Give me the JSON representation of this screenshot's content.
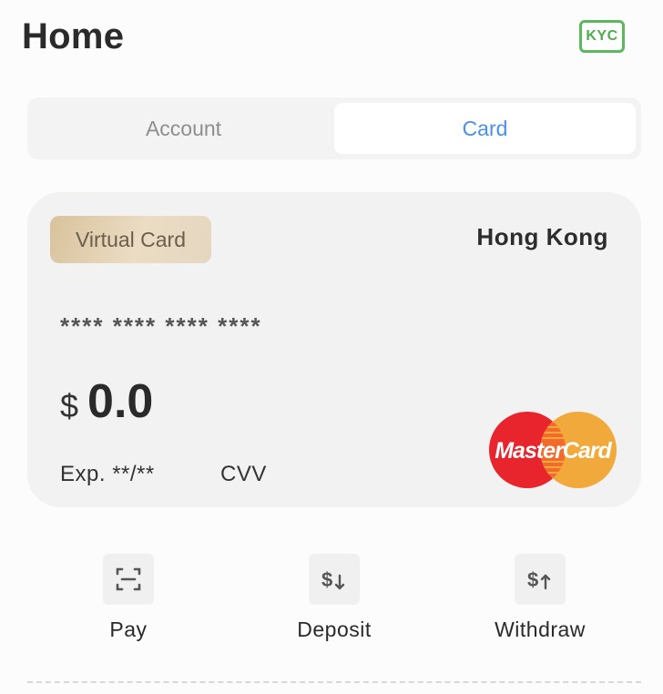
{
  "header": {
    "title": "Home",
    "kyc_label": "KYC"
  },
  "tabs": [
    {
      "label": "Account",
      "active": false
    },
    {
      "label": "Card",
      "active": true
    }
  ],
  "card": {
    "type_label": "Virtual Card",
    "region": "Hong Kong",
    "masked_number": "**** **** **** ****",
    "currency_symbol": "$",
    "balance": "0.0",
    "expiry": "Exp. **/**",
    "cvv_label": "CVV",
    "network_logo_text": "MasterCard"
  },
  "actions": [
    {
      "label": "Pay",
      "icon": "scan-icon"
    },
    {
      "label": "Deposit",
      "icon": "deposit-icon"
    },
    {
      "label": "Withdraw",
      "icon": "withdraw-icon"
    }
  ],
  "colors": {
    "accent": "#4a8ff0",
    "kyc_green": "#5cb85c",
    "mastercard_red": "#e8242d",
    "mastercard_orange": "#f2a93b"
  }
}
